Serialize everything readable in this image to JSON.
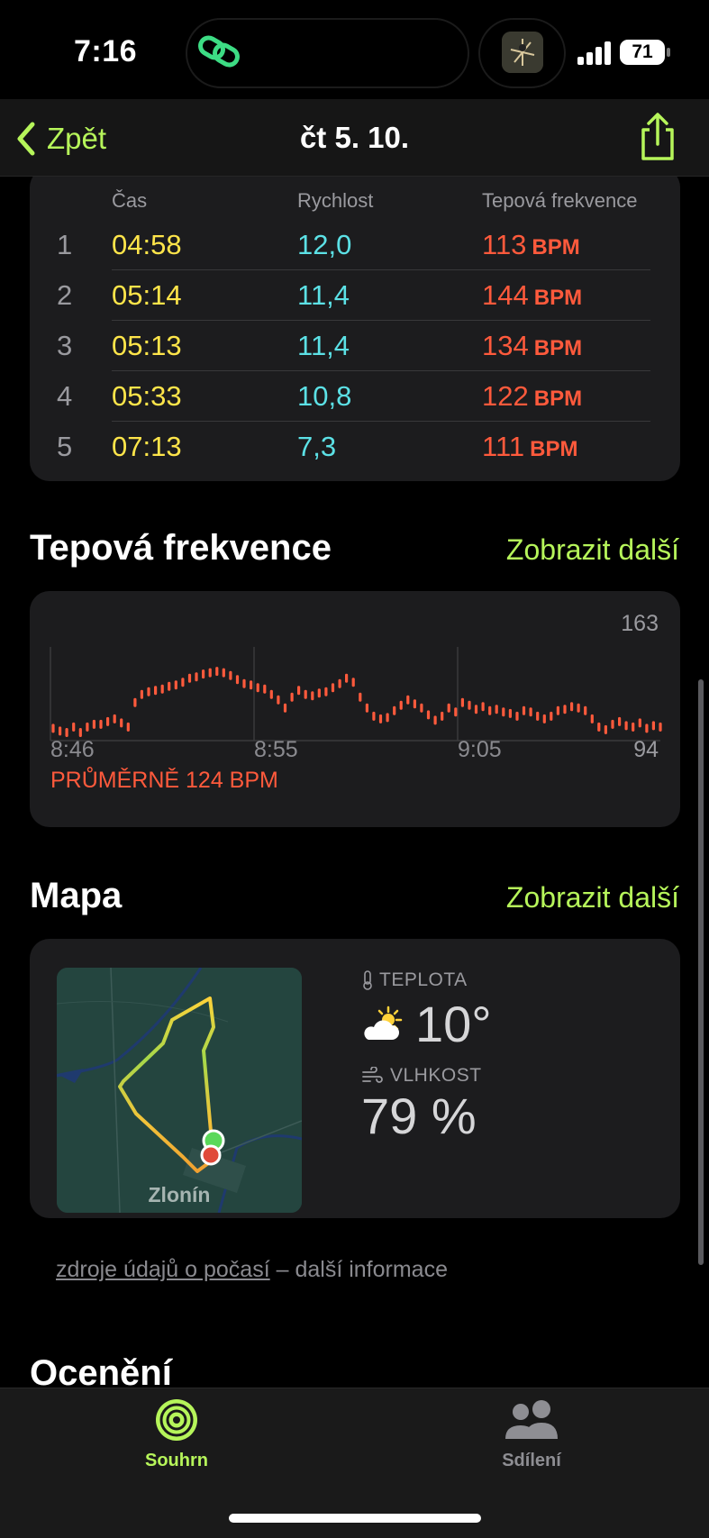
{
  "status_bar": {
    "time": "7:16",
    "battery": "71"
  },
  "nav": {
    "back_label": "Zpět",
    "title": "čt 5. 10."
  },
  "splits": {
    "headers": {
      "time": "Čas",
      "speed": "Rychlost",
      "hr": "Tepová frekvence"
    },
    "unit": "BPM",
    "rows": [
      {
        "n": "1",
        "time": "04:58",
        "speed": "12,0",
        "hr": "113"
      },
      {
        "n": "2",
        "time": "05:14",
        "speed": "11,4",
        "hr": "144"
      },
      {
        "n": "3",
        "time": "05:13",
        "speed": "11,4",
        "hr": "134"
      },
      {
        "n": "4",
        "time": "05:33",
        "speed": "10,8",
        "hr": "122"
      },
      {
        "n": "5",
        "time": "07:13",
        "speed": "7,3",
        "hr": "111"
      }
    ]
  },
  "heart_rate": {
    "title": "Tepová frekvence",
    "more": "Zobrazit další",
    "max_label": "163",
    "min_label": "94",
    "x_ticks": [
      "8:46",
      "8:55",
      "9:05"
    ],
    "average": "PRŮMĚRNĚ 124 BPM",
    "colors": {
      "accent": "#ff5a3c"
    }
  },
  "chart_data": {
    "type": "scatter",
    "title": "",
    "xlabel": "",
    "ylabel": "",
    "x_ticks": [
      "8:46",
      "8:55",
      "9:05"
    ],
    "ylim": [
      94,
      163
    ],
    "values": [
      103,
      101,
      100,
      104,
      100,
      104,
      106,
      106,
      108,
      110,
      107,
      104,
      122,
      128,
      130,
      131,
      132,
      134,
      135,
      137,
      140,
      141,
      143,
      144,
      145,
      144,
      142,
      139,
      136,
      135,
      133,
      132,
      128,
      124,
      118,
      126,
      131,
      128,
      127,
      129,
      130,
      133,
      136,
      140,
      137,
      126,
      118,
      112,
      110,
      111,
      116,
      120,
      124,
      121,
      118,
      113,
      109,
      112,
      118,
      115,
      122,
      120,
      117,
      119,
      116,
      117,
      115,
      114,
      112,
      116,
      115,
      112,
      110,
      112,
      116,
      117,
      119,
      118,
      116,
      110,
      104,
      102,
      106,
      108,
      105,
      104,
      107,
      103,
      105,
      104
    ]
  },
  "map": {
    "title": "Mapa",
    "more": "Zobrazit další",
    "town": "Zlonín",
    "temp_label": "TEPLOTA",
    "temp_value": "10°",
    "humidity_label": "VLHKOST",
    "humidity_value": "79 %"
  },
  "footnote": {
    "link": "zdroje údajů o počasí",
    "rest": " – další informace"
  },
  "awards_title": "Ocenění",
  "tabs": {
    "summary": "Souhrn",
    "sharing": "Sdílení"
  },
  "colors": {
    "accent": "#b6f55a",
    "time": "#ffe54a",
    "speed": "#5ce1e6",
    "hr": "#ff5a3c"
  }
}
